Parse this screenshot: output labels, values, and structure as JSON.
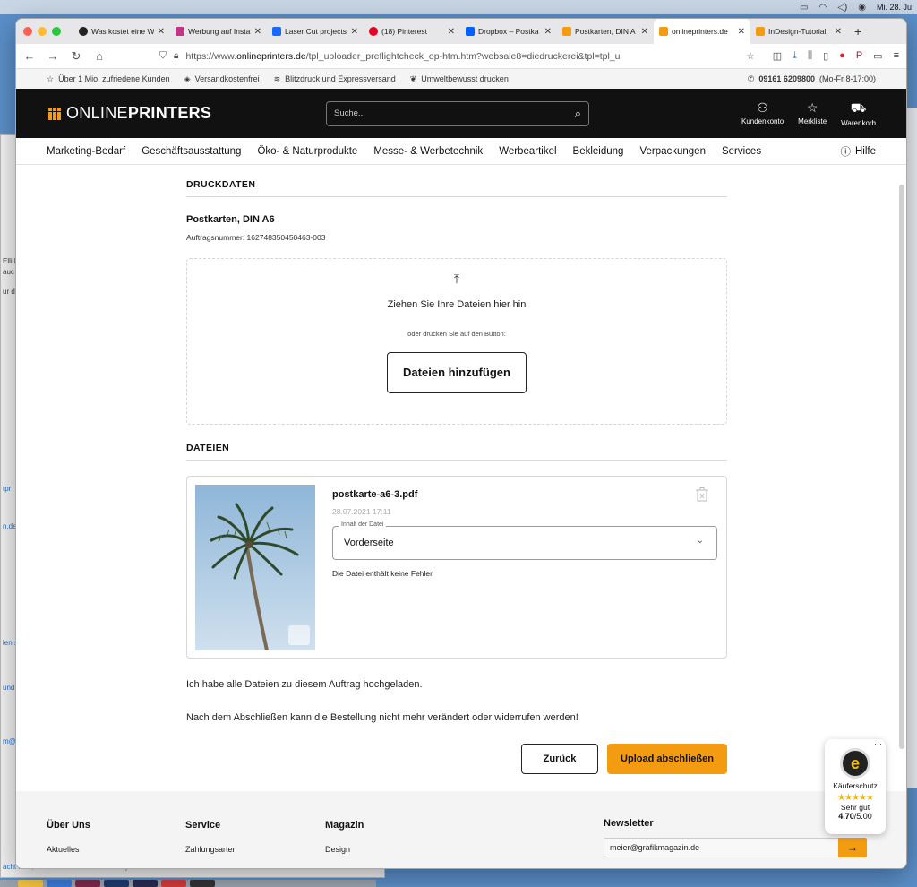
{
  "menubar": {
    "datetime": "Mi. 28. Ju"
  },
  "browser": {
    "tabs": [
      {
        "label": "Was kostet eine W",
        "color": "#222"
      },
      {
        "label": "Werbung auf Insta",
        "color": "#c13584"
      },
      {
        "label": "Laser Cut projects",
        "color": "#1769ff"
      },
      {
        "label": "(18) Pinterest",
        "color": "#e60023"
      },
      {
        "label": "Dropbox – Postka",
        "color": "#0061ff"
      },
      {
        "label": "Postkarten, DIN A",
        "color": "#f39c12"
      },
      {
        "label": "onlineprinters.de",
        "color": "#f39c12"
      },
      {
        "label": "InDesign-Tutorial:",
        "color": "#f39c12"
      }
    ],
    "url_prefix": "https://www.",
    "url_domain": "onlineprinters.de",
    "url_path": "/tpl_uploader_preflightcheck_op-htm.htm?websale8=diedruckerei&tpl=tpl_u"
  },
  "infobar": {
    "items": [
      "Über 1 Mio. zufriedene Kunden",
      "Versandkostenfrei",
      "Blitzdruck und Expressversand",
      "Umweltbewusst drucken"
    ],
    "phone": "09161 6209800",
    "hours": "(Mo-Fr 8-17:00)"
  },
  "header": {
    "logo_a": "ONLINE",
    "logo_b": "PRINTERS",
    "search_placeholder": "Suche...",
    "account": "Kundenkonto",
    "wishlist": "Merkliste",
    "cart": "Warenkorb"
  },
  "nav": {
    "items": [
      "Marketing-Bedarf",
      "Geschäftsausstattung",
      "Öko- & Naturprodukte",
      "Messe- & Werbetechnik",
      "Werbeartikel",
      "Bekleidung",
      "Verpackungen",
      "Services"
    ],
    "help": "Hilfe"
  },
  "druckdaten": {
    "title": "DRUCKDATEN",
    "product": "Postkarten, DIN A6",
    "order_number": "Auftragsnummer: 162748350450463-003",
    "drop_text": "Ziehen Sie Ihre Dateien hier hin",
    "or_text": "oder drücken Sie auf den Button:",
    "add_button": "Dateien hinzufügen"
  },
  "dateien": {
    "title": "DATEIEN",
    "file_name": "postkarte-a6-3.pdf",
    "file_date": "28.07.2021 17:11",
    "content_label": "Inhalt der Datei",
    "content_value": "Vorderseite",
    "status": "Die Datei enthält keine Fehler"
  },
  "confirm_text": "Ich habe alle Dateien zu diesem Auftrag hochgeladen.",
  "warning_text": "Nach dem Abschließen kann die Bestellung nicht mehr verändert oder widerrufen werden!",
  "buttons": {
    "back": "Zurück",
    "finish": "Upload abschließen"
  },
  "footer": {
    "cols": [
      {
        "title": "Über Uns",
        "link": "Aktuelles"
      },
      {
        "title": "Service",
        "link": "Zahlungsarten"
      },
      {
        "title": "Magazin",
        "link": "Design"
      }
    ],
    "newsletter_title": "Newsletter",
    "newsletter_value": "meier@grafikmagazin.de"
  },
  "trust": {
    "label": "Käuferschutz",
    "stars": "★★★★★",
    "rating_text": "Sehr gut",
    "score": "4.70",
    "max": "/5.00"
  },
  "colors": {
    "accent": "#f39c12",
    "header_bg": "#111111"
  }
}
